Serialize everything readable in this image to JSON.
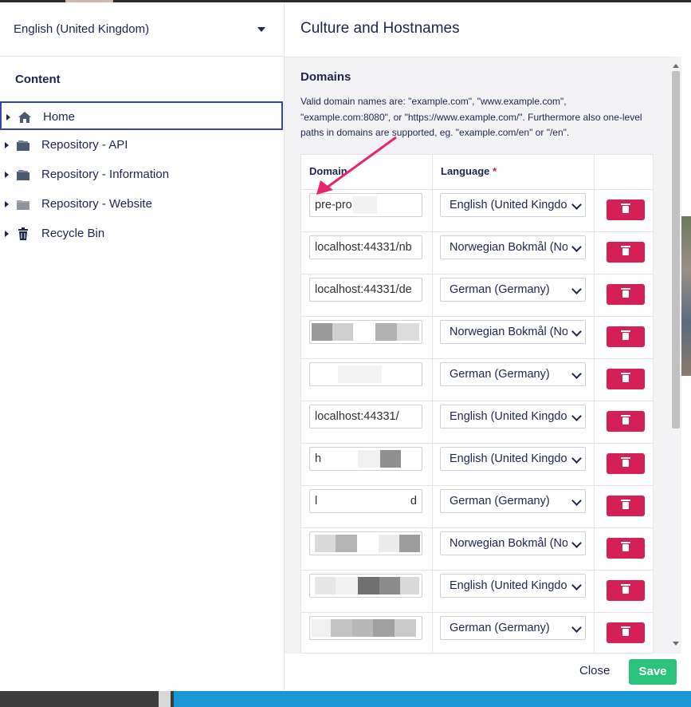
{
  "tree": {
    "language": "English (United Kingdom)",
    "section": "Content",
    "items": [
      {
        "label": "Home",
        "icon": "home-icon"
      },
      {
        "label": "Repository - API",
        "icon": "folder-icon"
      },
      {
        "label": "Repository - Information",
        "icon": "folder-icon"
      },
      {
        "label": "Repository - Website",
        "icon": "folder-icon"
      },
      {
        "label": "Recycle Bin",
        "icon": "trash-icon"
      }
    ]
  },
  "dialog": {
    "title": "Culture and Hostnames",
    "section_title": "Domains",
    "description": "Valid domain names are: \"example.com\", \"www.example.com\", \"example.com:8080\", or \"https://www.example.com/\". Furthermore also one-level paths in domains are supported, eg. \"example.com/en\" or \"/en\".",
    "columns": {
      "domain": "Domain",
      "language": "Language",
      "required_mark": "*"
    },
    "rows": [
      {
        "domain": "pre-pro",
        "language": "English (United Kingdom)"
      },
      {
        "domain": "localhost:44331/nb",
        "language": "Norwegian Bokmål (Norway)"
      },
      {
        "domain": "localhost:44331/de",
        "language": "German (Germany)"
      },
      {
        "domain": "",
        "language": "Norwegian Bokmål (Norway)"
      },
      {
        "domain": "",
        "language": "German (Germany)"
      },
      {
        "domain": "localhost:44331/",
        "language": "English (United Kingdom)"
      },
      {
        "domain": "h",
        "language": "English (United Kingdom)"
      },
      {
        "domain": "l",
        "domain_end": "d",
        "language": "German (Germany)"
      },
      {
        "domain": "",
        "language": "Norwegian Bokmål (Norway)"
      },
      {
        "domain": "",
        "language": "English (United Kingdom)"
      },
      {
        "domain": "",
        "language": "German (Germany)"
      }
    ],
    "close_label": "Close",
    "save_label": "Save"
  },
  "colors": {
    "accent": "#3544b1",
    "danger": "#d42054",
    "success": "#2bc37c",
    "annotation": "#e8246f"
  }
}
